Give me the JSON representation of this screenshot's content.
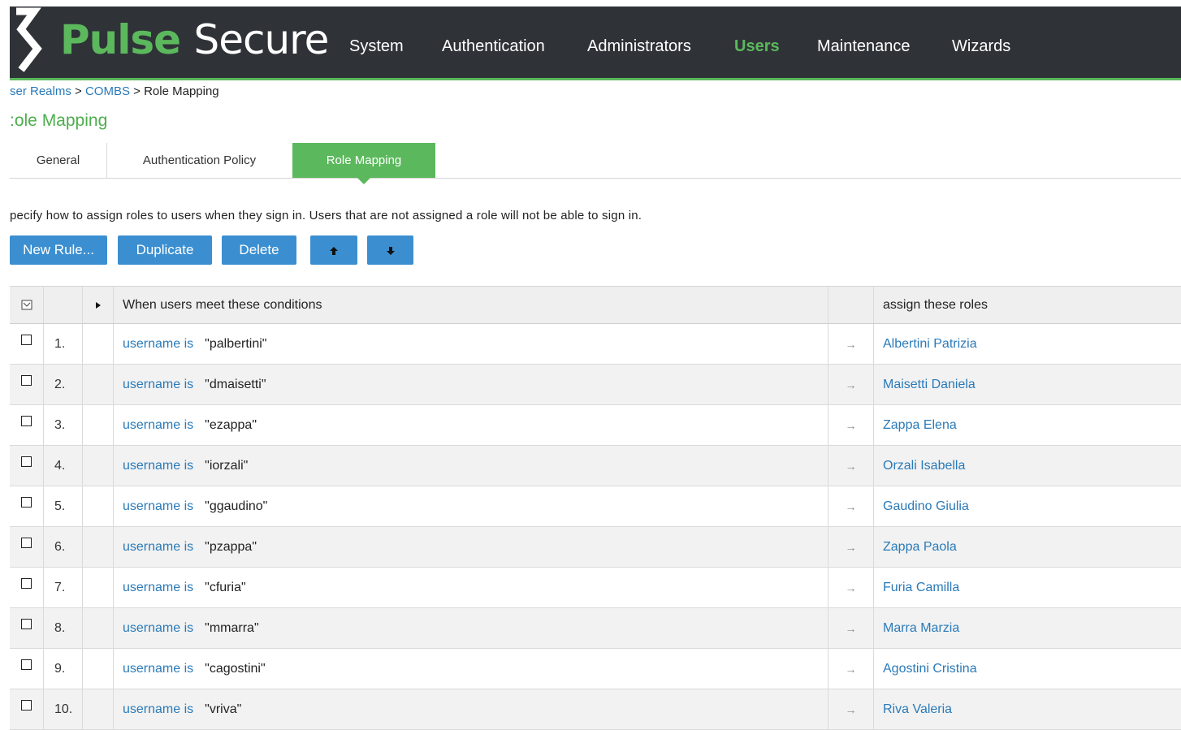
{
  "header": {
    "logo_part1": "Pulse",
    "logo_part2": "Secure",
    "nav": [
      {
        "label": "System",
        "active": false
      },
      {
        "label": "Authentication",
        "active": false
      },
      {
        "label": "Administrators",
        "active": false
      },
      {
        "label": "Users",
        "active": true
      },
      {
        "label": "Maintenance",
        "active": false
      },
      {
        "label": "Wizards",
        "active": false
      }
    ]
  },
  "breadcrumb": {
    "item1": "ser Realms",
    "sep1": " > ",
    "item2": "COMBS",
    "sep2": " > ",
    "current": "Role Mapping"
  },
  "page_title": ":ole Mapping",
  "tabs": [
    {
      "label": "General",
      "active": false
    },
    {
      "label": "Authentication Policy",
      "active": false
    },
    {
      "label": "Role Mapping",
      "active": true
    }
  ],
  "description": "pecify how to assign roles to users when they sign in. Users that are not assigned a role will not be able to sign in.",
  "toolbar": {
    "new_rule": "New Rule...",
    "duplicate": "Duplicate",
    "delete": "Delete",
    "move_up_icon": "arrow-up-icon",
    "move_down_icon": "arrow-down-icon"
  },
  "table": {
    "header_conditions": "When users meet these conditions",
    "header_roles": "assign these roles",
    "arrow_glyph": "→",
    "rows": [
      {
        "num": "1.",
        "keyword": "username is",
        "value": "\"palbertini\"",
        "role": "Albertini Patrizia"
      },
      {
        "num": "2.",
        "keyword": "username is",
        "value": "\"dmaisetti\"",
        "role": "Maisetti Daniela"
      },
      {
        "num": "3.",
        "keyword": "username is",
        "value": "\"ezappa\"",
        "role": "Zappa Elena"
      },
      {
        "num": "4.",
        "keyword": "username is",
        "value": "\"iorzali\"",
        "role": "Orzali Isabella"
      },
      {
        "num": "5.",
        "keyword": "username is",
        "value": "\"ggaudino\"",
        "role": "Gaudino Giulia"
      },
      {
        "num": "6.",
        "keyword": "username is",
        "value": "\"pzappa\"",
        "role": "Zappa Paola"
      },
      {
        "num": "7.",
        "keyword": "username is",
        "value": "\"cfuria\"",
        "role": "Furia Camilla"
      },
      {
        "num": "8.",
        "keyword": "username is",
        "value": "\"mmarra\"",
        "role": "Marra Marzia"
      },
      {
        "num": "9.",
        "keyword": "username is",
        "value": "\"cagostini\"",
        "role": "Agostini Cristina"
      },
      {
        "num": "10.",
        "keyword": "username is",
        "value": "\"vriva\"",
        "role": "Riva Valeria"
      }
    ]
  },
  "colors": {
    "brand_green": "#5cb85c",
    "header_bg": "#2f3338",
    "button_blue": "#3b8fd1",
    "link_blue": "#2a7ab8"
  }
}
